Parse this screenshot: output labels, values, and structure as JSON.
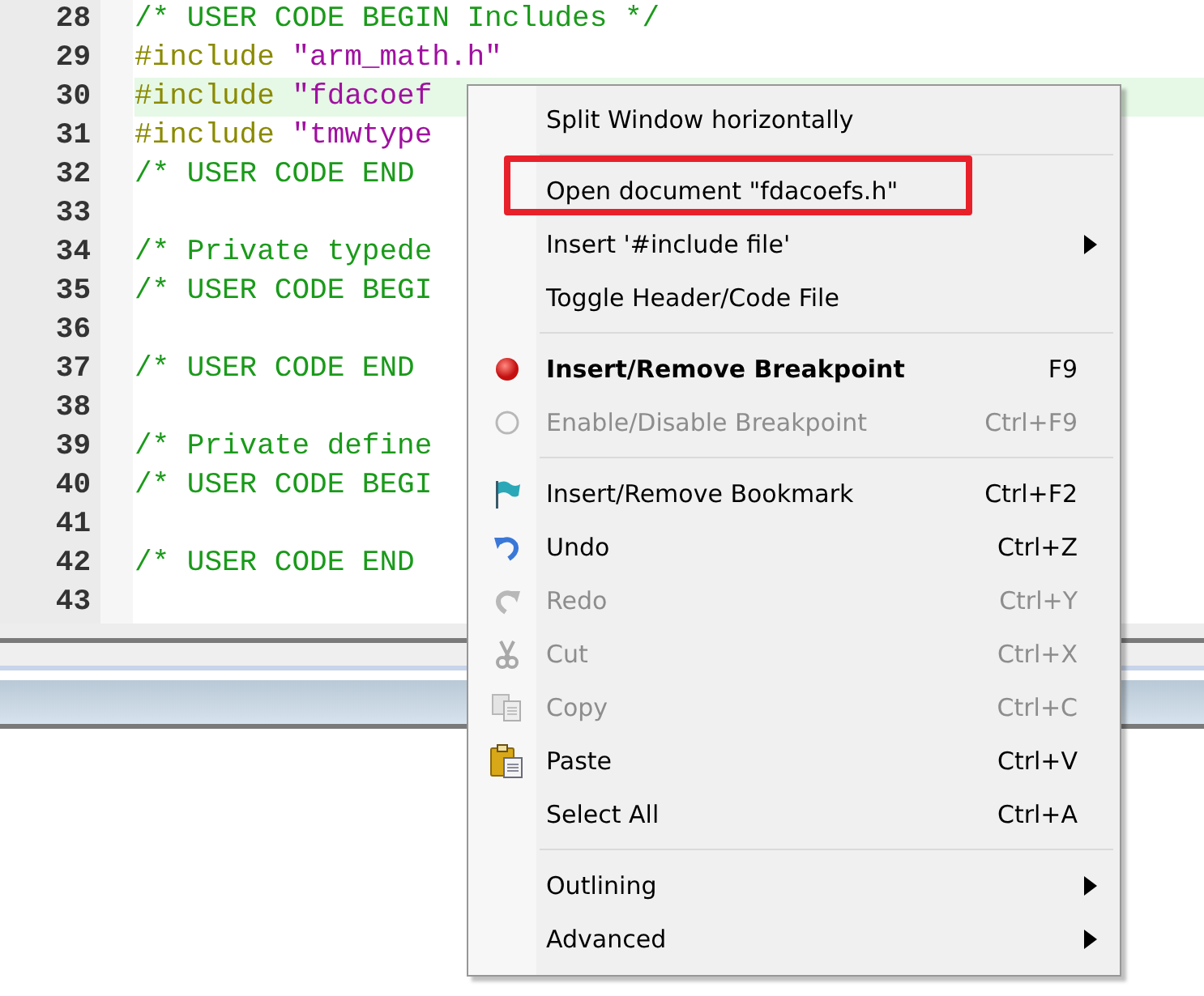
{
  "editor": {
    "lines": [
      {
        "number": "28",
        "current": false,
        "parts": [
          {
            "kind": "comment",
            "text": "/* USER CODE BEGIN Includes */"
          }
        ]
      },
      {
        "number": "29",
        "current": false,
        "parts": [
          {
            "kind": "directive",
            "text": "#include "
          },
          {
            "kind": "string",
            "text": "\"arm_math.h\""
          }
        ]
      },
      {
        "number": "30",
        "current": true,
        "parts": [
          {
            "kind": "directive",
            "text": "#include "
          },
          {
            "kind": "string",
            "text": "\"fdacoef"
          }
        ]
      },
      {
        "number": "31",
        "current": false,
        "parts": [
          {
            "kind": "directive",
            "text": "#include "
          },
          {
            "kind": "string",
            "text": "\"tmwtype"
          }
        ]
      },
      {
        "number": "32",
        "current": false,
        "parts": [
          {
            "kind": "comment",
            "text": "/* USER CODE END"
          }
        ]
      },
      {
        "number": "33",
        "current": false
      },
      {
        "number": "34",
        "current": false,
        "parts": [
          {
            "kind": "comment",
            "text": "/* Private typede"
          }
        ]
      },
      {
        "number": "35",
        "current": false,
        "parts": [
          {
            "kind": "comment",
            "text": "/* USER CODE BEGI"
          }
        ]
      },
      {
        "number": "36",
        "current": false
      },
      {
        "number": "37",
        "current": false,
        "parts": [
          {
            "kind": "comment",
            "text": "/* USER CODE END"
          }
        ]
      },
      {
        "number": "38",
        "current": false
      },
      {
        "number": "39",
        "current": false,
        "parts": [
          {
            "kind": "comment",
            "text": "/* Private define"
          }
        ]
      },
      {
        "number": "40",
        "current": false,
        "parts": [
          {
            "kind": "comment",
            "text": "/* USER CODE BEGI"
          }
        ]
      },
      {
        "number": "41",
        "current": false
      },
      {
        "number": "42",
        "current": false,
        "parts": [
          {
            "kind": "comment",
            "text": "/* USER CODE END"
          }
        ]
      },
      {
        "number": "43",
        "current": false
      }
    ]
  },
  "context_menu": {
    "groups": [
      [
        {
          "label": "Split Window horizontally",
          "disabled": false,
          "bold": false,
          "submenu": false,
          "highlighted": false
        }
      ],
      [
        {
          "label": "Open document \"fdacoefs.h\"",
          "disabled": false,
          "bold": false,
          "submenu": false,
          "highlighted": true
        },
        {
          "label": "Insert '#include file'",
          "disabled": false,
          "bold": false,
          "submenu": true,
          "highlighted": false
        },
        {
          "label": "Toggle Header/Code File",
          "disabled": false,
          "bold": false,
          "submenu": false,
          "highlighted": false
        }
      ],
      [
        {
          "label": "Insert/Remove Breakpoint",
          "shortcut": "F9",
          "disabled": false,
          "bold": true,
          "submenu": false,
          "highlighted": false
        },
        {
          "label": "Enable/Disable Breakpoint",
          "shortcut": "Ctrl+F9",
          "disabled": true,
          "bold": false,
          "submenu": false,
          "highlighted": false
        }
      ],
      [
        {
          "label": "Insert/Remove Bookmark",
          "shortcut": "Ctrl+F2",
          "disabled": false,
          "bold": false,
          "submenu": false,
          "highlighted": false
        },
        {
          "label": "Undo",
          "shortcut": "Ctrl+Z",
          "disabled": false,
          "bold": false,
          "submenu": false,
          "highlighted": false
        },
        {
          "label": "Redo",
          "shortcut": "Ctrl+Y",
          "disabled": true,
          "bold": false,
          "submenu": false,
          "highlighted": false
        },
        {
          "label": "Cut",
          "shortcut": "Ctrl+X",
          "disabled": true,
          "bold": false,
          "submenu": false,
          "highlighted": false
        },
        {
          "label": "Copy",
          "shortcut": "Ctrl+C",
          "disabled": true,
          "bold": false,
          "submenu": false,
          "highlighted": false
        },
        {
          "label": "Paste",
          "shortcut": "Ctrl+V",
          "disabled": false,
          "bold": false,
          "submenu": false,
          "highlighted": false
        },
        {
          "label": "Select All",
          "shortcut": "Ctrl+A",
          "disabled": false,
          "bold": false,
          "submenu": false,
          "highlighted": false
        }
      ],
      [
        {
          "label": "Outlining",
          "disabled": false,
          "bold": false,
          "submenu": true,
          "highlighted": false
        },
        {
          "label": "Advanced",
          "disabled": false,
          "bold": false,
          "submenu": true,
          "highlighted": false
        }
      ]
    ]
  }
}
